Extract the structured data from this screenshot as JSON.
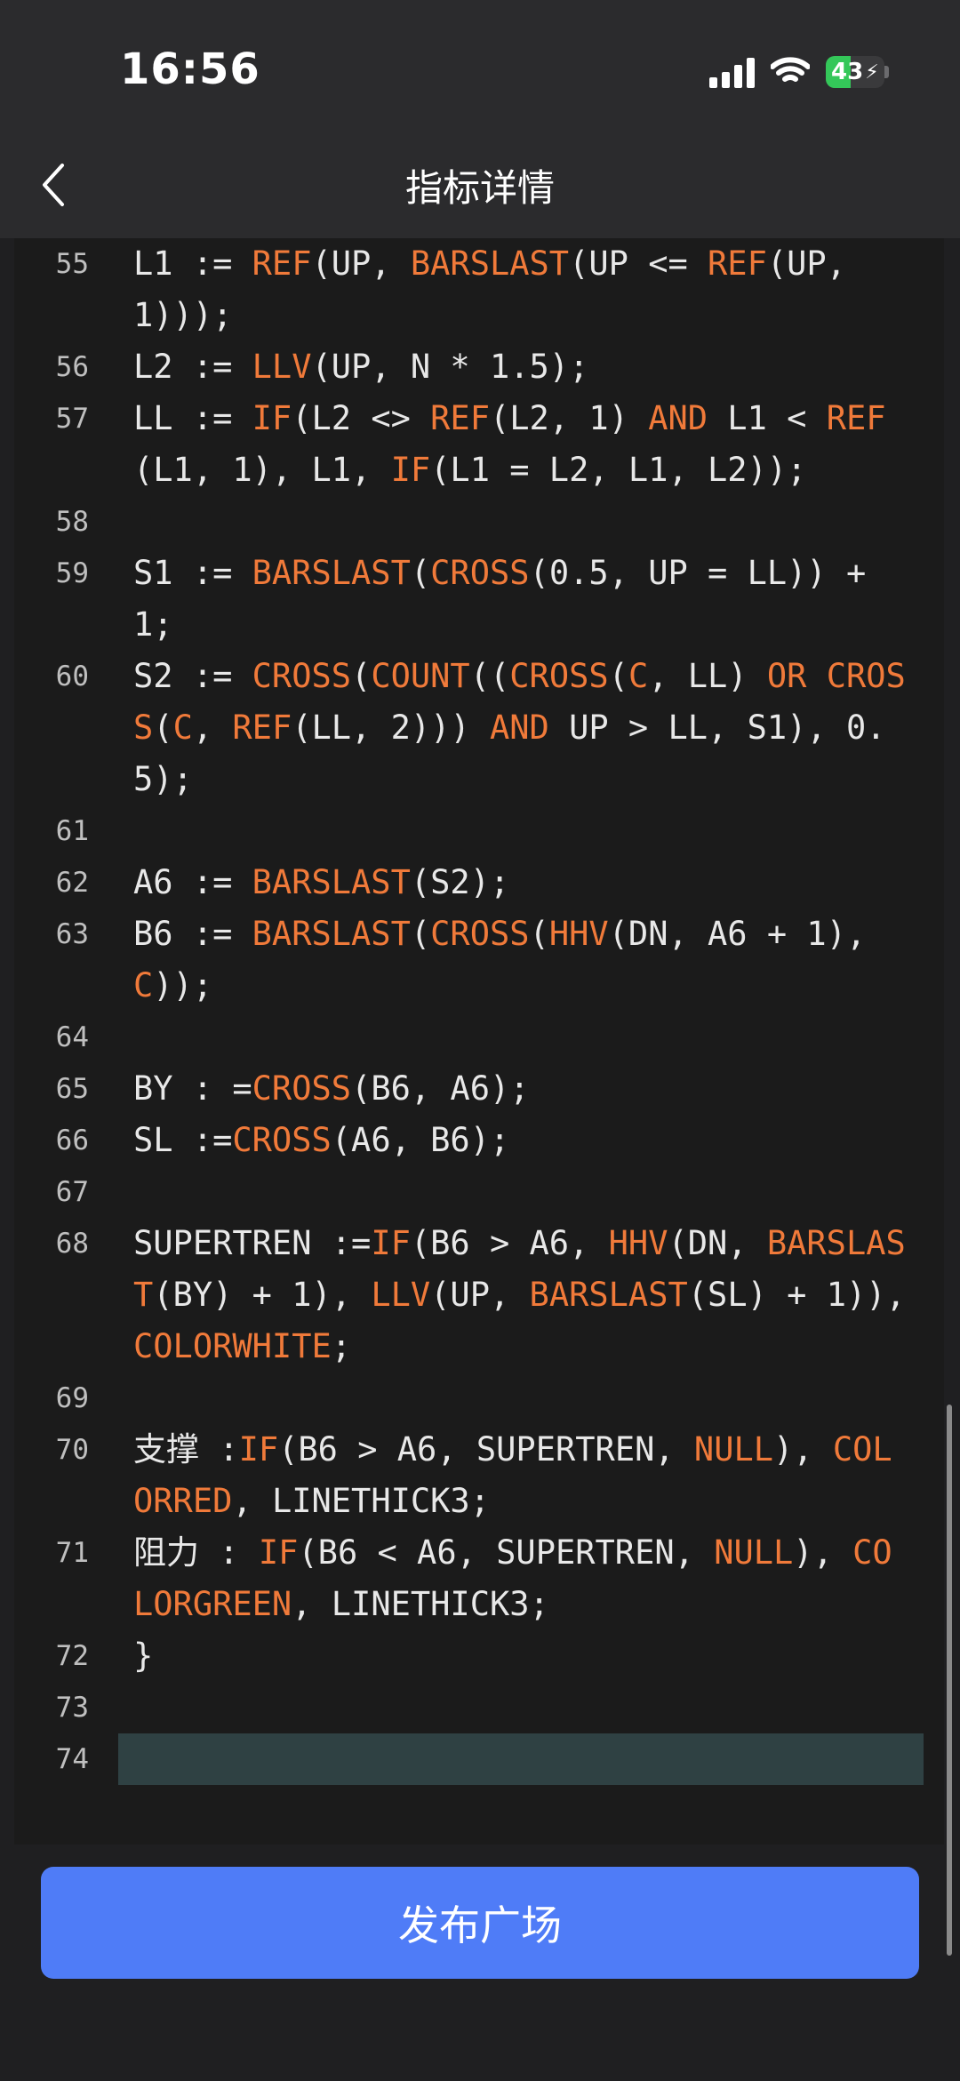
{
  "status_bar": {
    "time": "16:56",
    "battery": "43"
  },
  "header": {
    "title": "指标详情"
  },
  "editor": {
    "lines": [
      {
        "num": "55",
        "tokens": [
          {
            "t": "L1 := "
          },
          {
            "t": "REF",
            "k": 1
          },
          {
            "t": "(UP, "
          },
          {
            "t": "BARSLAST",
            "k": 1
          },
          {
            "t": "(UP <= "
          },
          {
            "t": "REF",
            "k": 1
          },
          {
            "t": "(UP, 1)));"
          }
        ]
      },
      {
        "num": "56",
        "tokens": [
          {
            "t": "L2 := "
          },
          {
            "t": "LLV",
            "k": 1
          },
          {
            "t": "(UP, N * 1.5);"
          }
        ]
      },
      {
        "num": "57",
        "tokens": [
          {
            "t": "LL := "
          },
          {
            "t": "IF",
            "k": 1
          },
          {
            "t": "(L2 <> "
          },
          {
            "t": "REF",
            "k": 1
          },
          {
            "t": "(L2, 1) "
          },
          {
            "t": "AND",
            "k": 1
          },
          {
            "t": " L1 < "
          },
          {
            "t": "REF",
            "k": 1
          },
          {
            "t": "(L1, 1), L1, "
          },
          {
            "t": "IF",
            "k": 1
          },
          {
            "t": "(L1 = L2, L1, L2));"
          }
        ]
      },
      {
        "num": "58",
        "tokens": []
      },
      {
        "num": "59",
        "tokens": [
          {
            "t": "S1 := "
          },
          {
            "t": "BARSLAST",
            "k": 1
          },
          {
            "t": "("
          },
          {
            "t": "CROSS",
            "k": 1
          },
          {
            "t": "(0.5, UP = LL)) + 1;"
          }
        ]
      },
      {
        "num": "60",
        "tokens": [
          {
            "t": "S2 := "
          },
          {
            "t": "CROSS",
            "k": 1
          },
          {
            "t": "("
          },
          {
            "t": "COUNT",
            "k": 1
          },
          {
            "t": "(("
          },
          {
            "t": "CROSS",
            "k": 1
          },
          {
            "t": "("
          },
          {
            "t": "C",
            "k": 1
          },
          {
            "t": ", LL) "
          },
          {
            "t": "OR",
            "k": 1
          },
          {
            "t": " "
          },
          {
            "t": "CROSS",
            "k": 1
          },
          {
            "t": "("
          },
          {
            "t": "C",
            "k": 1
          },
          {
            "t": ", "
          },
          {
            "t": "REF",
            "k": 1
          },
          {
            "t": "(LL, 2))) "
          },
          {
            "t": "AND",
            "k": 1
          },
          {
            "t": " UP > LL, S1), 0.5);"
          }
        ]
      },
      {
        "num": "61",
        "tokens": []
      },
      {
        "num": "62",
        "tokens": [
          {
            "t": "A6 := "
          },
          {
            "t": "BARSLAST",
            "k": 1
          },
          {
            "t": "(S2);"
          }
        ]
      },
      {
        "num": "63",
        "tokens": [
          {
            "t": "B6 := "
          },
          {
            "t": "BARSLAST",
            "k": 1
          },
          {
            "t": "("
          },
          {
            "t": "CROSS",
            "k": 1
          },
          {
            "t": "("
          },
          {
            "t": "HHV",
            "k": 1
          },
          {
            "t": "(DN, A6 + 1), "
          },
          {
            "t": "C",
            "k": 1
          },
          {
            "t": "));"
          }
        ]
      },
      {
        "num": "64",
        "tokens": []
      },
      {
        "num": "65",
        "tokens": [
          {
            "t": "BY : ="
          },
          {
            "t": "CROSS",
            "k": 1
          },
          {
            "t": "(B6, A6);"
          }
        ]
      },
      {
        "num": "66",
        "tokens": [
          {
            "t": "SL :="
          },
          {
            "t": "CROSS",
            "k": 1
          },
          {
            "t": "(A6, B6);"
          }
        ]
      },
      {
        "num": "67",
        "tokens": []
      },
      {
        "num": "68",
        "tokens": [
          {
            "t": "SUPERTREN :="
          },
          {
            "t": "IF",
            "k": 1
          },
          {
            "t": "(B6 > A6, "
          },
          {
            "t": "HHV",
            "k": 1
          },
          {
            "t": "(DN, "
          },
          {
            "t": "BARSLAST",
            "k": 1
          },
          {
            "t": "(BY) + 1), "
          },
          {
            "t": "LLV",
            "k": 1
          },
          {
            "t": "(UP, "
          },
          {
            "t": "BARSLAST",
            "k": 1
          },
          {
            "t": "(SL) + 1)), "
          },
          {
            "t": "COLORWHITE",
            "k": 1
          },
          {
            "t": ";"
          }
        ]
      },
      {
        "num": "69",
        "tokens": []
      },
      {
        "num": "70",
        "tokens": [
          {
            "t": "支撑 :"
          },
          {
            "t": "IF",
            "k": 1
          },
          {
            "t": "(B6 > A6, SUPERTREN, "
          },
          {
            "t": "NULL",
            "k": 1
          },
          {
            "t": "), "
          },
          {
            "t": "COLORRED",
            "k": 1
          },
          {
            "t": ", LINETHICK3;"
          }
        ]
      },
      {
        "num": "71",
        "tokens": [
          {
            "t": "阻力 : "
          },
          {
            "t": "IF",
            "k": 1
          },
          {
            "t": "(B6 < A6, SUPERTREN, "
          },
          {
            "t": "NULL",
            "k": 1
          },
          {
            "t": "), "
          },
          {
            "t": "COLORGREEN",
            "k": 1
          },
          {
            "t": ", LINETHICK3;"
          }
        ]
      },
      {
        "num": "72",
        "tokens": [
          {
            "t": "}"
          }
        ]
      },
      {
        "num": "73",
        "tokens": []
      },
      {
        "num": "74",
        "tokens": [],
        "active": true
      }
    ]
  },
  "footer": {
    "publish_label": "发布广场"
  }
}
